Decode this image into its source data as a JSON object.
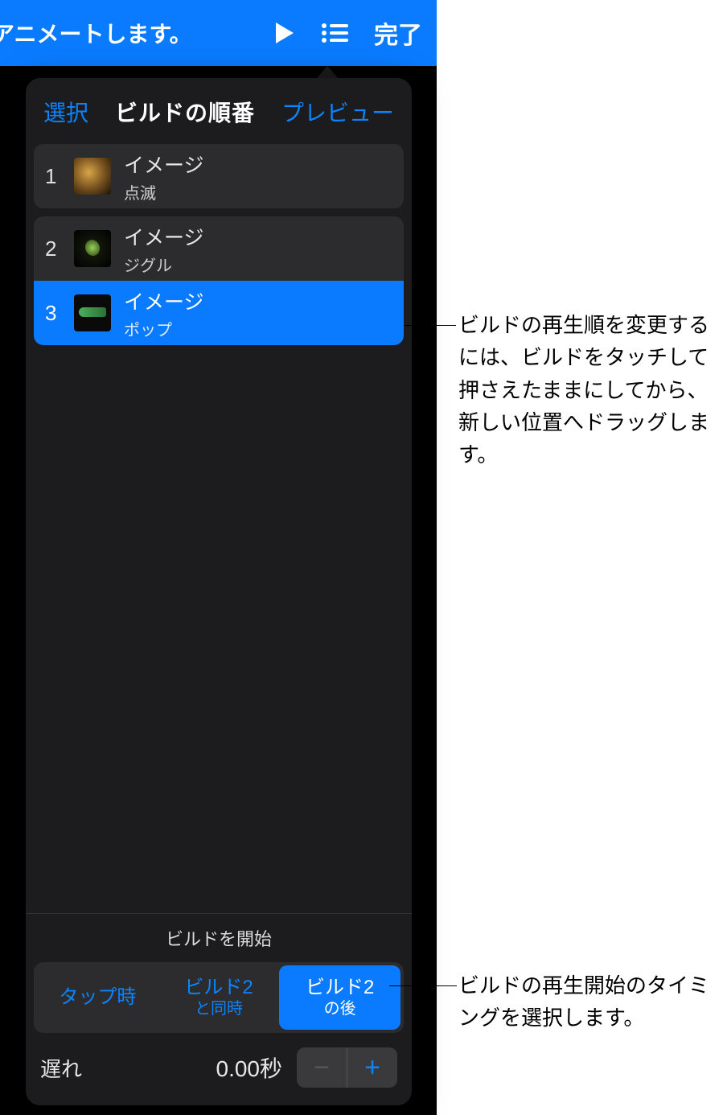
{
  "toolbar": {
    "title": "アニメートします。",
    "done": "完了"
  },
  "popover": {
    "select": "選択",
    "title": "ビルドの順番",
    "preview": "プレビュー"
  },
  "builds": [
    {
      "num": "1",
      "name": "イメージ",
      "effect": "点滅"
    },
    {
      "num": "2",
      "name": "イメージ",
      "effect": "ジグル"
    },
    {
      "num": "3",
      "name": "イメージ",
      "effect": "ポップ"
    }
  ],
  "start": {
    "label": "ビルドを開始",
    "options": [
      {
        "line1": "タップ時",
        "line2": ""
      },
      {
        "line1": "ビルド2",
        "line2": "と同時"
      },
      {
        "line1": "ビルド2",
        "line2": "の後"
      }
    ]
  },
  "delay": {
    "label": "遅れ",
    "value": "0.00秒"
  },
  "callouts": {
    "reorder": "ビルドの再生順を変更するには、ビルドをタッチして押さえたままにしてから、新しい位置へドラッグします。",
    "timing": "ビルドの再生開始のタイミングを選択します。"
  }
}
